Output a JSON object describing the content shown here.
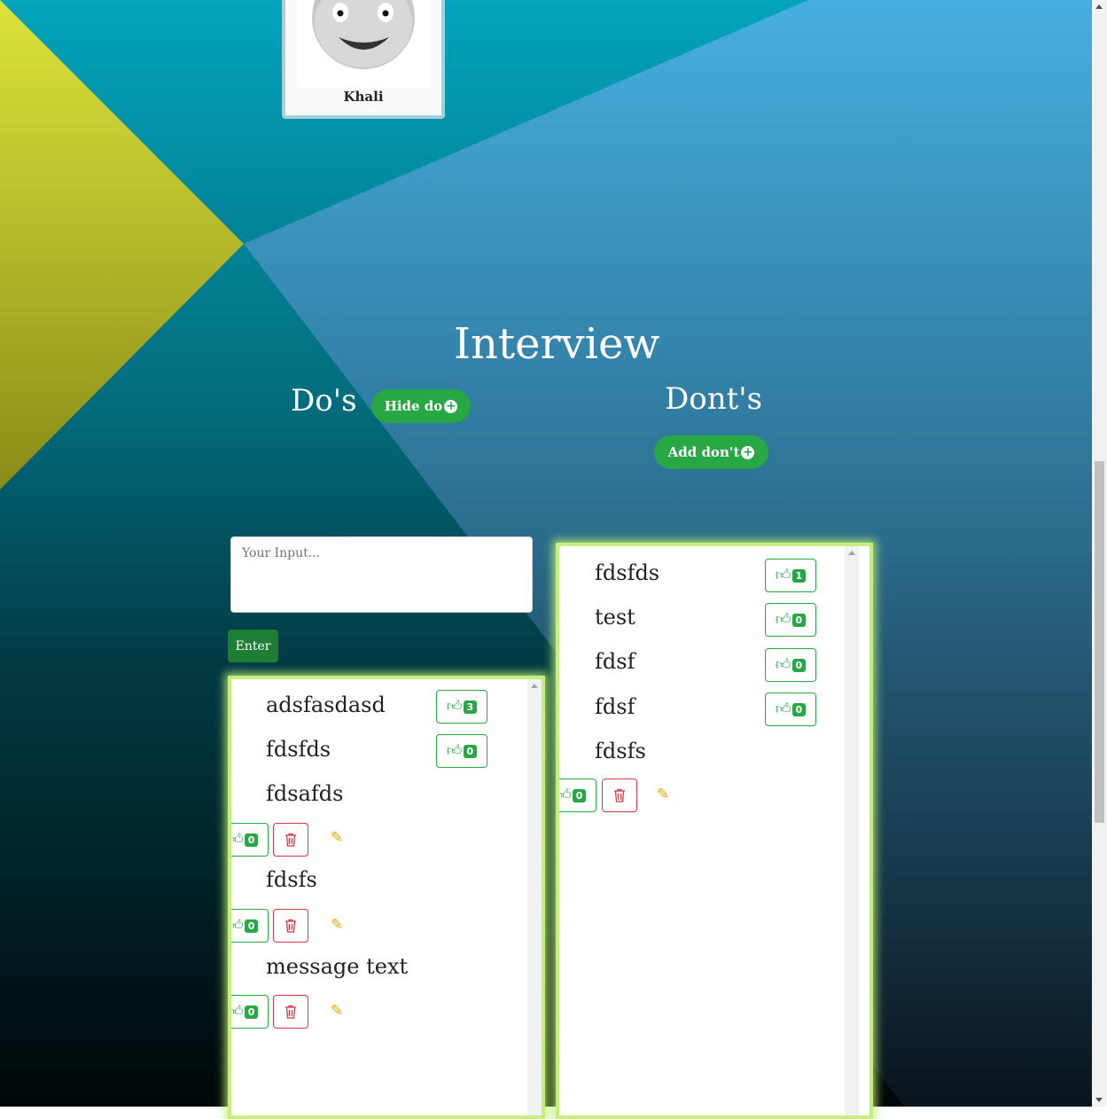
{
  "profile": {
    "name": "Khali"
  },
  "page": {
    "title": "Interview"
  },
  "dos": {
    "heading": "Do's",
    "toggle_label": "Hide do",
    "input_placeholder": "Your Input...",
    "enter_label": "Enter",
    "items": [
      {
        "text": "adsfasdasd",
        "likes": "3"
      },
      {
        "text": "fdsfds",
        "likes": "0"
      },
      {
        "text": "fdsafds",
        "likes": "0"
      },
      {
        "text": "fdsfs",
        "likes": "0"
      },
      {
        "text": "message text",
        "likes": "0"
      }
    ]
  },
  "donts": {
    "heading": "Dont's",
    "add_label": "Add don't",
    "items": [
      {
        "text": "fdsfds",
        "likes": "1"
      },
      {
        "text": "test",
        "likes": "0"
      },
      {
        "text": "fdsf",
        "likes": "0"
      },
      {
        "text": "fdsf",
        "likes": "0"
      },
      {
        "text": "fdsfs",
        "likes": "0"
      }
    ]
  },
  "icons": {
    "like": "thumbs-up-icon",
    "delete": "trash-icon",
    "edit": "edit-icon",
    "add": "plus-circle-icon"
  },
  "colors": {
    "success": "#28a745",
    "danger": "#dc3545",
    "warning": "#f0a500",
    "panel_glow": "#c6ef7a"
  }
}
